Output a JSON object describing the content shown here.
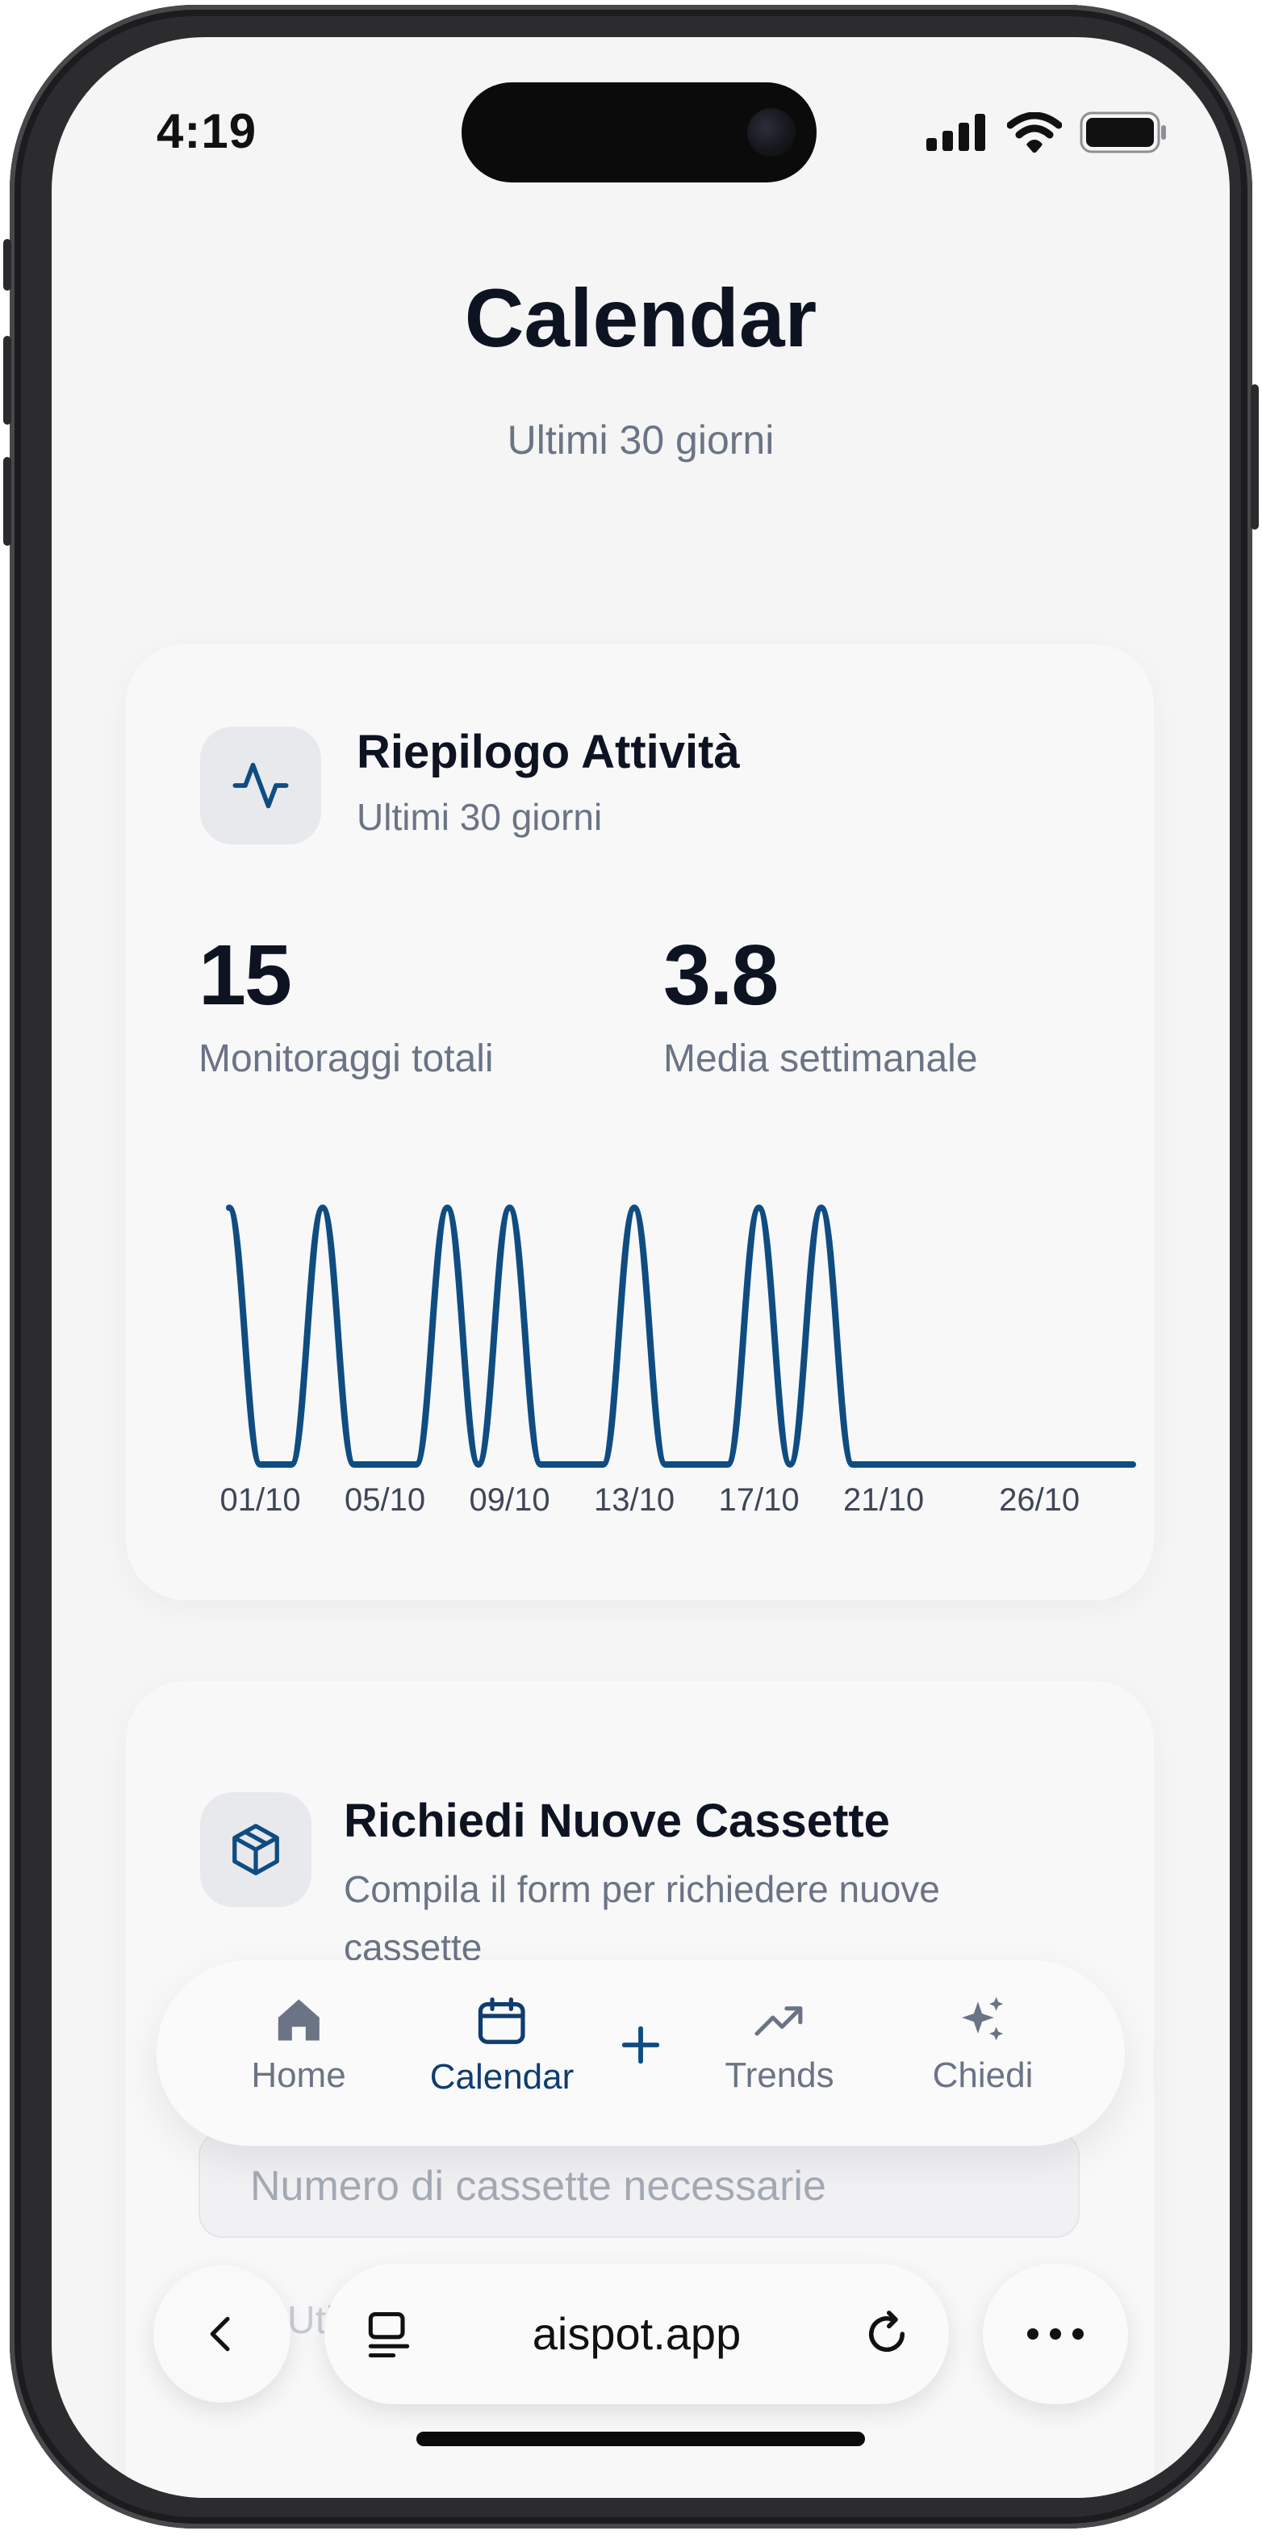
{
  "status_bar": {
    "time": "4:19"
  },
  "header": {
    "title": "Calendar",
    "subtitle": "Ultimi 30 giorni"
  },
  "activity_card": {
    "icon": "activity-pulse-icon",
    "title": "Riepilogo Attività",
    "subtitle": "Ultimi 30 giorni",
    "stats": [
      {
        "value": "15",
        "label": "Monitoraggi totali"
      },
      {
        "value": "3.8",
        "label": "Media settimanale"
      }
    ]
  },
  "chart_data": {
    "type": "line",
    "x_tick_labels": [
      "01/10",
      "05/10",
      "09/10",
      "13/10",
      "17/10",
      "21/10",
      "26/10"
    ],
    "series": [
      {
        "values": [
          1,
          0,
          0,
          1,
          0,
          0,
          0,
          1,
          0,
          1,
          0,
          0,
          0,
          1,
          0,
          0,
          0,
          1,
          0,
          1,
          0,
          0,
          0,
          0,
          0,
          0,
          0,
          0,
          0,
          0
        ]
      }
    ],
    "ylim": [
      0,
      1
    ],
    "grid": false,
    "color": "#0f4c81"
  },
  "request_card": {
    "icon": "package-icon",
    "title": "Richiedi Nuove Cassette",
    "subtitle": "Compila il form per richiedere nuove cassette",
    "input_placeholder": "Numero di cassette necessarie"
  },
  "nav": {
    "items": [
      {
        "label": "Home",
        "icon": "home-icon"
      },
      {
        "label": "Calendar",
        "icon": "calendar-icon",
        "active": true
      },
      {
        "label": "",
        "icon": "plus-icon"
      },
      {
        "label": "Trends",
        "icon": "trending-up-icon"
      },
      {
        "label": "Chiedi",
        "icon": "sparkles-icon"
      }
    ]
  },
  "browser": {
    "url": "aispot.app"
  },
  "colors": {
    "accent": "#0f4c81",
    "muted": "#6b7485",
    "text": "#0d1321"
  }
}
